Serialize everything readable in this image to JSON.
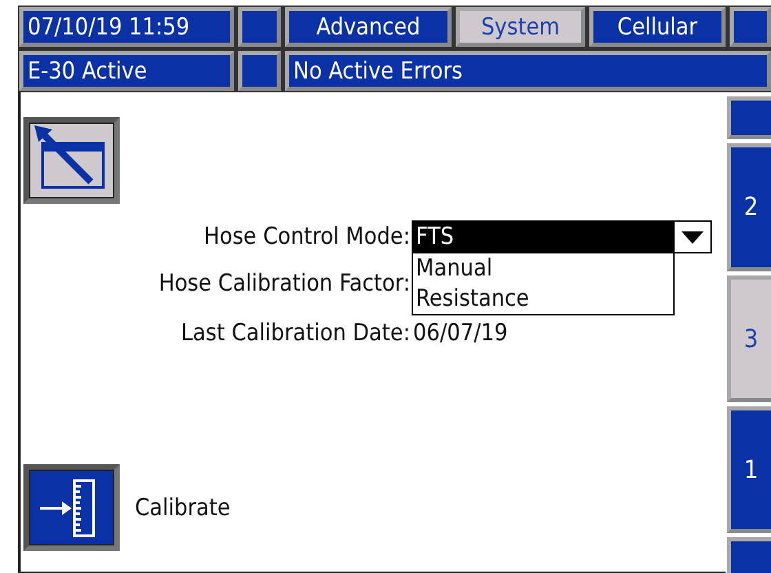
{
  "header": {
    "datetime": "07/10/19 11:59",
    "tabs": [
      {
        "label": "Advanced",
        "selected": false
      },
      {
        "label": "System",
        "selected": true
      },
      {
        "label": "Cellular",
        "selected": false
      }
    ],
    "status": "E-30 Active",
    "errors": "No Active Errors"
  },
  "side_tabs": [
    {
      "selected": false
    },
    {
      "label": "2",
      "selected": false
    },
    {
      "label": "3",
      "selected": true
    },
    {
      "label": "1",
      "selected": false
    },
    {
      "selected": false
    }
  ],
  "fields": [
    {
      "kind": "dropdown",
      "label": "Hose Control Mode:",
      "value": "FTS",
      "expanded": true,
      "options": [
        "Manual",
        "Resistance"
      ]
    },
    {
      "kind": "value",
      "label": "Hose Calibration Factor:"
    },
    {
      "kind": "value",
      "label": "Last Calibration Date:",
      "value": "06/07/19"
    }
  ],
  "calibrate": {
    "label": "Calibrate"
  }
}
